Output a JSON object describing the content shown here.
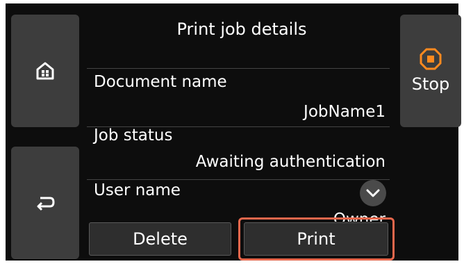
{
  "header": {
    "title": "Print job details"
  },
  "details": [
    {
      "label": "Document name",
      "value": "JobName1"
    },
    {
      "label": "Job status",
      "value": "Awaiting authentication"
    },
    {
      "label": "User name",
      "value": "Owner"
    }
  ],
  "sidebar": {
    "home_icon": "home-icon",
    "back_icon": "back-arrow-icon",
    "stop_label": "Stop",
    "stop_icon": "stop-icon"
  },
  "actions": {
    "delete_label": "Delete",
    "print_label": "Print"
  },
  "colors": {
    "accent": "#e8674c",
    "stop_icon": "#ff8a1f",
    "button_bg": "#3d3d3d"
  }
}
